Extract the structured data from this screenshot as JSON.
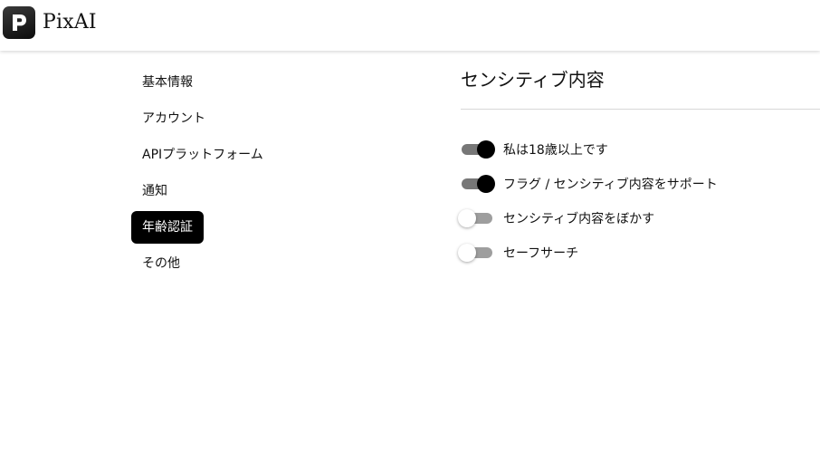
{
  "header": {
    "logo_letter": "P",
    "app_name": "PixAI"
  },
  "sidebar": {
    "items": [
      {
        "label": "基本情報",
        "active": false
      },
      {
        "label": "アカウント",
        "active": false
      },
      {
        "label": "APIプラットフォーム",
        "active": false
      },
      {
        "label": "通知",
        "active": false
      },
      {
        "label": "年齢認証",
        "active": true
      },
      {
        "label": "その他",
        "active": false
      }
    ]
  },
  "main": {
    "title": "センシティブ内容",
    "toggles": [
      {
        "label": "私は18歳以上です",
        "on": true
      },
      {
        "label": "フラグ / センシティブ内容をサポート",
        "on": true
      },
      {
        "label": "センシティブ内容をぼかす",
        "on": false
      },
      {
        "label": "セーフサーチ",
        "on": false
      }
    ]
  },
  "colors": {
    "accent": "#000000",
    "switch_track_on": "#777777",
    "switch_track_off": "#9e9e9e"
  }
}
